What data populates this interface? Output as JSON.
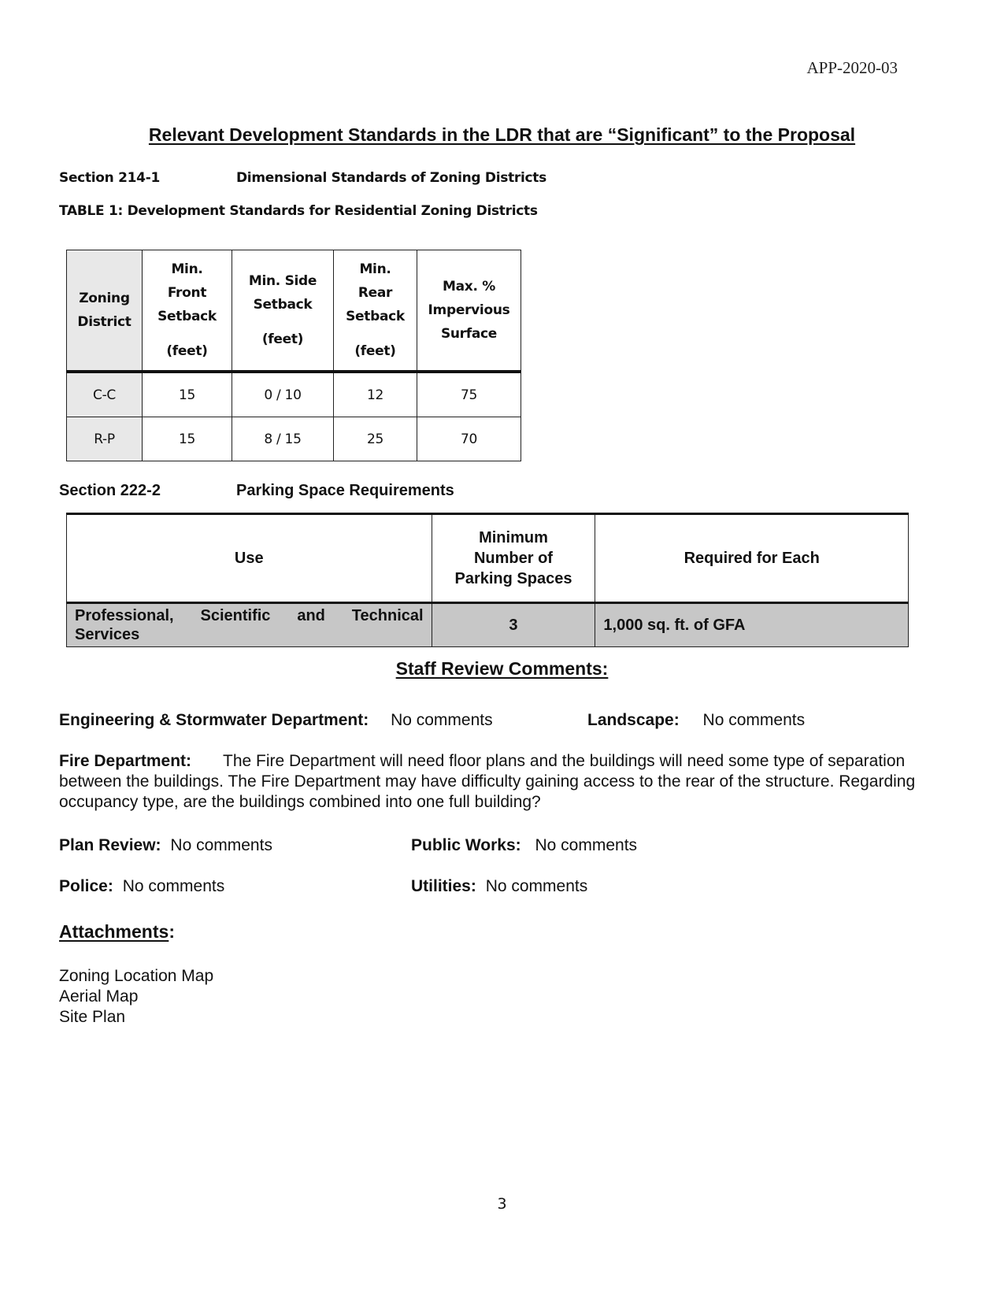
{
  "header": {
    "doc_id": "APP-2020-03"
  },
  "title": "Relevant  Development  Standards  in  the LDR  that  are “Significant” to the Proposal",
  "section1": {
    "number": "Section 214-1",
    "title": "Dimensional Standards of Zoning Districts"
  },
  "table1": {
    "caption": "TABLE  1:   Development Standards for Residential Zoning Districts",
    "headers": [
      {
        "lines": [
          "Zoning",
          "District"
        ]
      },
      {
        "lines": [
          "Min.",
          "Front",
          "Setback",
          "(feet)"
        ]
      },
      {
        "lines": [
          "Min. Side",
          "Setback",
          "(feet)"
        ]
      },
      {
        "lines": [
          "Min.",
          "Rear",
          "Setback",
          "(feet)"
        ]
      },
      {
        "lines": [
          "Max.  %",
          "Impervious",
          "Surface"
        ]
      }
    ],
    "rows": [
      [
        "C-C",
        "15",
        "0  /  10",
        "12",
        "75"
      ],
      [
        "R-P",
        "15",
        "8 / 15",
        "25",
        "70"
      ]
    ]
  },
  "section2": {
    "number": "Section  222-2",
    "title": "Parking Space Requirements"
  },
  "table2": {
    "headers": [
      {
        "lines": [
          "Use"
        ]
      },
      {
        "lines": [
          "Minimum",
          "Number of",
          "Parking Spaces"
        ]
      },
      {
        "lines": [
          "Required for Each"
        ]
      }
    ],
    "rows": [
      [
        "Professional,  Scientific  and  Technical Services",
        "3",
        "1,000 sq. ft. of GFA"
      ]
    ]
  },
  "staff_review": {
    "heading": "Staff  Review  Comments:",
    "engineering": {
      "label": "Engineering & Stormwater Department:",
      "value": "No comments"
    },
    "landscape": {
      "label": "Landscape:",
      "value": "No comments"
    },
    "fire": {
      "label": "Fire Department:",
      "value": "The Fire Department will need floor plans and the buildings will need some type of separation between the buildings. The Fire Department may have difficulty gaining access to the rear of the structure. Regarding occupancy type, are the buildings combined into one full building?"
    },
    "plan_review": {
      "label": "Plan Review:",
      "value": "No comments"
    },
    "public_works": {
      "label": "Public Works:",
      "value": "No comments"
    },
    "police": {
      "label": "Police:",
      "value": "No comments"
    },
    "utilities": {
      "label": "Utilities:",
      "value": "No comments"
    }
  },
  "attachments": {
    "heading": "Attachments",
    "colon": ":",
    "items": [
      "Zoning Location Map",
      "Aerial Map",
      "Site Plan"
    ]
  },
  "footer": {
    "page_number": "3"
  }
}
